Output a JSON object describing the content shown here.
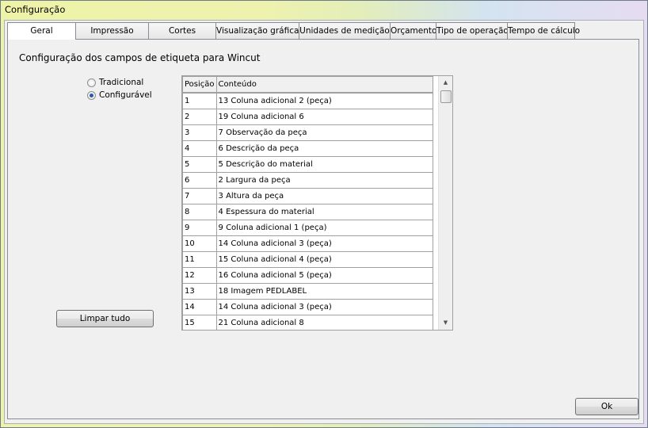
{
  "window": {
    "title": "Configuração"
  },
  "tabs": [
    {
      "label": "Geral",
      "active": true
    },
    {
      "label": "Impressão",
      "active": false
    },
    {
      "label": "Cortes",
      "active": false
    },
    {
      "label": "Visualização gráfica",
      "active": false
    },
    {
      "label": "Unidades de medição",
      "active": false
    },
    {
      "label": "Orçamento",
      "active": false
    },
    {
      "label": "Tipo de operação",
      "active": false
    },
    {
      "label": "Tempo de cálculo",
      "active": false
    }
  ],
  "panel": {
    "heading": "Configuração dos campos de etiqueta para Wincut",
    "radio_traditional": "Tradicional",
    "radio_configurable": "Configurável",
    "selected_mode": "Configurável",
    "clear_button": "Limpar tudo"
  },
  "grid": {
    "columns": [
      "Posição",
      "Conteúdo"
    ],
    "rows": [
      [
        "1",
        "13 Coluna adicional 2 (peça)"
      ],
      [
        "2",
        "19 Coluna adicional 6"
      ],
      [
        "3",
        "7  Observação da peça"
      ],
      [
        "4",
        "6  Descrição da peça"
      ],
      [
        "5",
        "5  Descrição do material"
      ],
      [
        "6",
        "2  Largura da peça"
      ],
      [
        "7",
        "3  Altura da peça"
      ],
      [
        "8",
        "4  Espessura do material"
      ],
      [
        "9",
        "9  Coluna adicional 1 (peça)"
      ],
      [
        "10",
        "14 Coluna adicional 3 (peça)"
      ],
      [
        "11",
        "15 Coluna adicional 4 (peça)"
      ],
      [
        "12",
        "16 Coluna adicional 5 (peça)"
      ],
      [
        "13",
        "18 Imagem PEDLABEL"
      ],
      [
        "14",
        "14 Coluna adicional 3 (peça)"
      ],
      [
        "15",
        "21 Coluna adicional 8"
      ]
    ]
  },
  "ok_button": "Ok"
}
